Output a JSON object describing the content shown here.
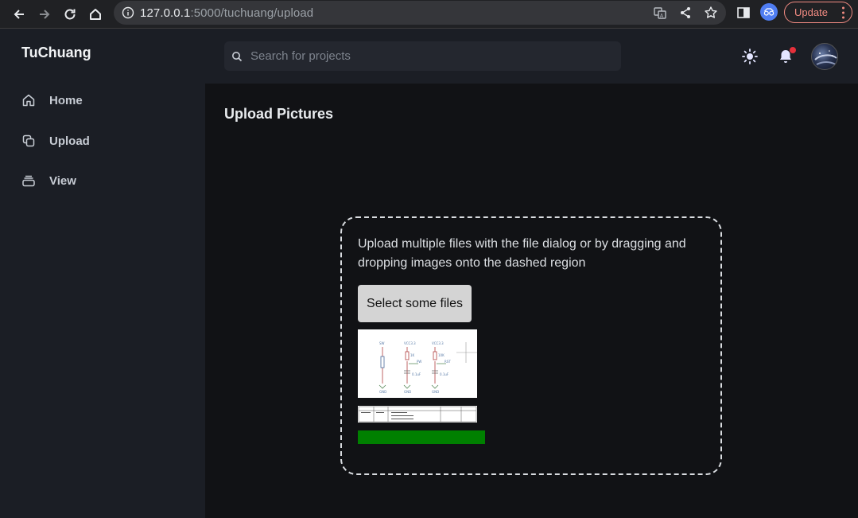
{
  "browser": {
    "url_host": "127.0.0.1",
    "url_rest": ":5000/tuchuang/upload",
    "update_label": "Update"
  },
  "app": {
    "brand": "TuChuang",
    "sidebar": {
      "items": [
        {
          "label": "Home",
          "icon": "home-icon"
        },
        {
          "label": "Upload",
          "icon": "copy-icon"
        },
        {
          "label": "View",
          "icon": "stack-icon"
        }
      ]
    },
    "search": {
      "placeholder": "Search for projects"
    },
    "page_title": "Upload Pictures",
    "upload": {
      "instructions": "Upload multiple files with the file dialog or by dragging and dropping images onto the dashed region",
      "select_label": "Select some files",
      "progress": 1.0
    }
  },
  "colors": {
    "sidebar_bg": "#1b1e25",
    "main_bg": "#111215",
    "progress": "#008000",
    "notification_dot": "#e5303b",
    "update_accent": "#f28b82"
  }
}
